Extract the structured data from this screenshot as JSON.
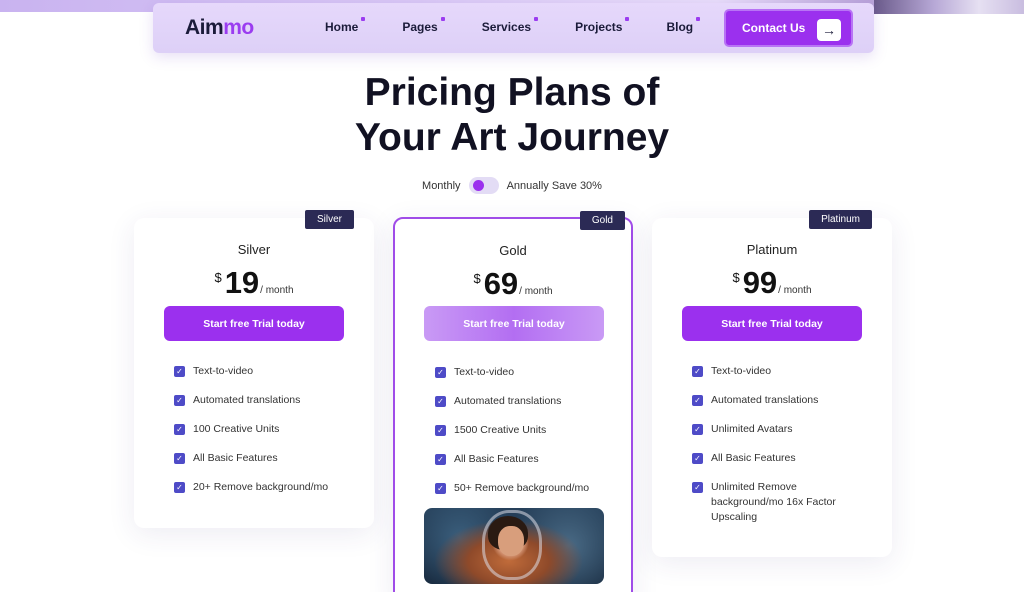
{
  "nav": {
    "logo_prefix": "Aim",
    "logo_suffix": "mo",
    "links": [
      {
        "label": "Home"
      },
      {
        "label": "Pages"
      },
      {
        "label": "Services"
      },
      {
        "label": "Projects"
      },
      {
        "label": "Blog"
      }
    ],
    "contact_label": "Contact Us",
    "contact_icon": "arrow-right-icon"
  },
  "heading": {
    "line1": "Pricing Plans of",
    "line2": "Your Art Journey"
  },
  "billing": {
    "monthly_label": "Monthly",
    "annual_label": "Annually Save 30%"
  },
  "plans": [
    {
      "badge": "Silver",
      "name": "Silver",
      "currency": "$",
      "price": "19",
      "period": "/ month",
      "cta": "Start free Trial today",
      "features": [
        "Text-to-video",
        "Automated translations",
        "100 Creative Units",
        "All Basic Features",
        "20+ Remove background/mo"
      ]
    },
    {
      "badge": "Gold",
      "name": "Gold",
      "currency": "$",
      "price": "69",
      "period": "/ month",
      "cta": "Start free Trial today",
      "features": [
        "Text-to-video",
        "Automated translations",
        "1500 Creative Units",
        "All Basic Features",
        "50+ Remove background/mo"
      ]
    },
    {
      "badge": "Platinum",
      "name": "Platinum",
      "currency": "$",
      "price": "99",
      "period": "/ month",
      "cta": "Start free Trial today",
      "features": [
        "Text-to-video",
        "Automated translations",
        "Unlimited Avatars",
        "All Basic Features",
        "Unlimited Remove background/mo 16x Factor Upscaling"
      ]
    }
  ],
  "colors": {
    "accent": "#9b30ee",
    "badge_bg": "#2b2a55",
    "check": "#4e4bc7"
  }
}
